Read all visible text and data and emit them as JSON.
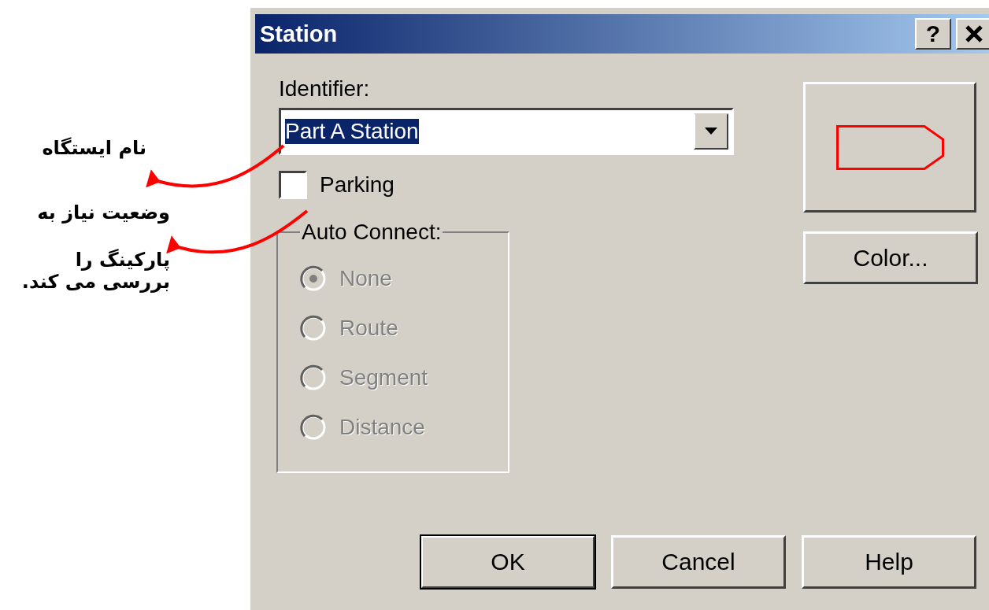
{
  "annotations": [
    {
      "kind": "single",
      "text": "نام ایستگاه"
    },
    {
      "kind": "lines",
      "lines": [
        "وضعیت نیاز به",
        "پارکینگ را",
        "بررسی می کند."
      ]
    }
  ],
  "window": {
    "title": "Station",
    "help_button": "?"
  },
  "identifier": {
    "label": "Identifier:",
    "value": "Part A Station",
    "value_selected": true
  },
  "parking": {
    "label": "Parking",
    "checked": false
  },
  "auto_connect": {
    "label": "Auto Connect:",
    "disabled": true,
    "options": [
      {
        "label": "None",
        "selected": true
      },
      {
        "label": "Route",
        "selected": false
      },
      {
        "label": "Segment",
        "selected": false
      },
      {
        "label": "Distance",
        "selected": false
      }
    ]
  },
  "color_button": "Color...",
  "buttons": [
    {
      "label": "OK",
      "default": true
    },
    {
      "label": "Cancel",
      "default": false
    },
    {
      "label": "Help",
      "default": false
    }
  ]
}
